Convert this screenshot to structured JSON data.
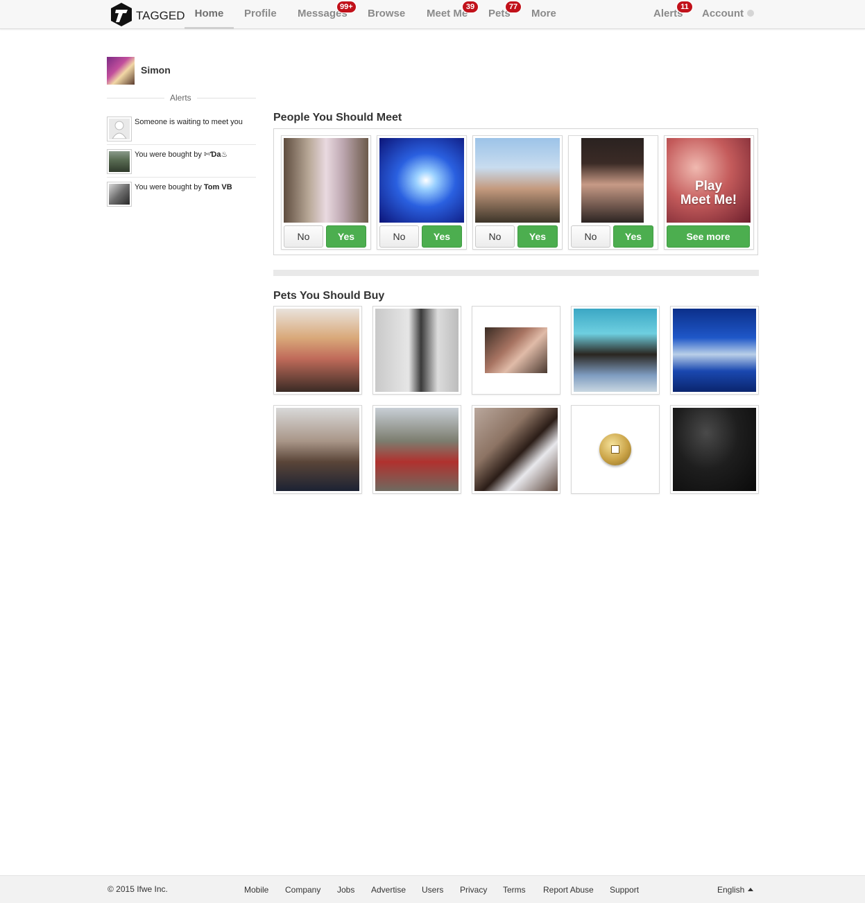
{
  "app": {
    "logo_text": "TAGGED"
  },
  "nav": {
    "home": "Home",
    "profile": "Profile",
    "messages": "Messages",
    "messages_badge": "99+",
    "browse": "Browse",
    "meetme": "Meet Me",
    "meetme_badge": "39",
    "pets": "Pets",
    "pets_badge": "77",
    "more": "More",
    "alerts": "Alerts",
    "alerts_badge": "11",
    "account": "Account"
  },
  "sidebar": {
    "user_name": "Simon",
    "alerts_heading": "Alerts",
    "alerts": [
      {
        "text": "Someone is waiting to meet you",
        "bold": ""
      },
      {
        "text": "You were bought by ",
        "bold": "✄Ɗa♨"
      },
      {
        "text": "You were bought by ",
        "bold": "Tom VB"
      }
    ]
  },
  "meet": {
    "title": "People You Should Meet",
    "no_label": "No",
    "yes_label": "Yes",
    "play_line1": "Play",
    "play_line2": "Meet Me!",
    "see_more": "See more"
  },
  "pets": {
    "title": "Pets You Should Buy"
  },
  "footer": {
    "copyright": "© 2015 Ifwe Inc.",
    "links": [
      "Mobile",
      "Company",
      "Jobs",
      "Advertise",
      "Users",
      "Privacy",
      "Terms",
      "Report Abuse",
      "Support"
    ],
    "language": "English"
  },
  "colors": {
    "badge_red": "#c1111a",
    "yes_green": "#4cae4f"
  }
}
